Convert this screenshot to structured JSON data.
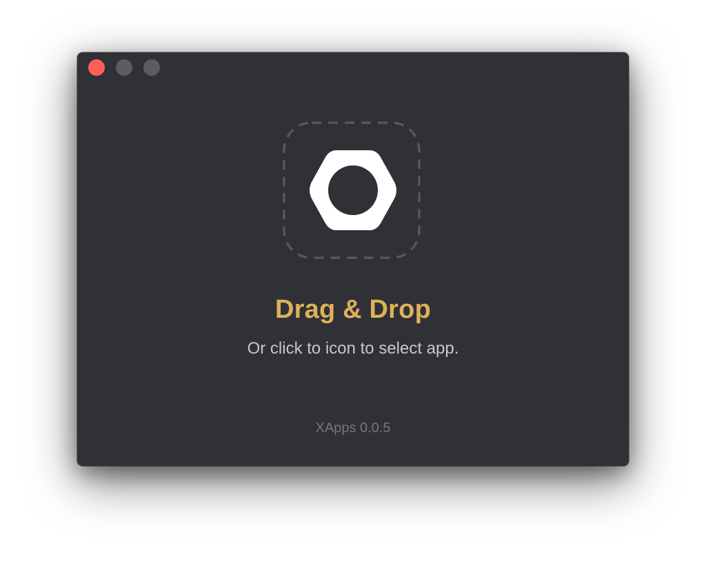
{
  "window": {
    "controls": {
      "close_icon": "close-dot-icon",
      "minimize_icon": "minimize-dot-icon",
      "zoom_icon": "zoom-dot-icon",
      "close_color": "#ff5f57",
      "inactive_color": "#5b5d62"
    },
    "background_color": "#2f3136"
  },
  "drop_zone": {
    "icon": "hex-nut-icon",
    "border_style": "dashed",
    "border_color": "#55575c"
  },
  "content": {
    "headline": "Drag & Drop",
    "headline_color": "#deb15a",
    "subtext": "Or click to icon to select app."
  },
  "footer": {
    "version": "XApps 0.0.5"
  }
}
